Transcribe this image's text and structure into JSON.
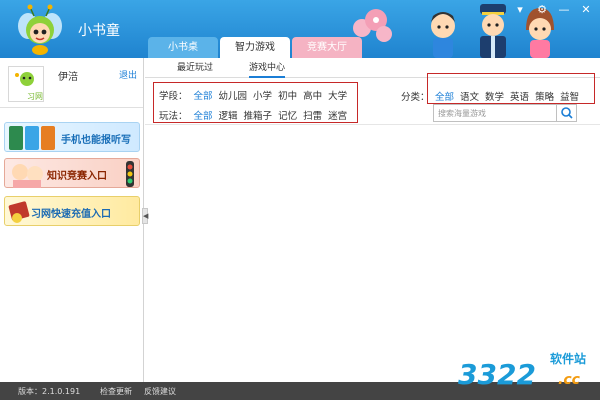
{
  "app": {
    "title": "小书童"
  },
  "window": {
    "menu_icon": "menu-icon",
    "settings_icon": "gear-icon",
    "minimize": "—",
    "close": "✕"
  },
  "tabs": [
    {
      "label": "小书桌",
      "active": false
    },
    {
      "label": "智力游戏",
      "active": true
    },
    {
      "label": "竞赛大厅",
      "active": false
    }
  ],
  "sidebar": {
    "username": "伊涪",
    "logout": "退出",
    "avatar_label": "习网",
    "banners": [
      {
        "text": "手机也能报听写"
      },
      {
        "text": "知识竞赛入口"
      },
      {
        "text": "习网快速充值入口"
      }
    ],
    "collapse_glyph": "◀"
  },
  "subtabs": [
    {
      "label": "最近玩过",
      "active": false
    },
    {
      "label": "游戏中心",
      "active": true
    }
  ],
  "filters": {
    "stage": {
      "label": "学段：",
      "options": [
        "全部",
        "幼儿园",
        "小学",
        "初中",
        "高中",
        "大学"
      ],
      "selected": "全部"
    },
    "play": {
      "label": "玩法：",
      "options": [
        "全部",
        "逻辑",
        "推箱子",
        "记忆",
        "扫雷",
        "迷宫"
      ],
      "selected": "全部"
    },
    "category": {
      "label": "分类：",
      "options": [
        "全部",
        "语文",
        "数学",
        "英语",
        "策略",
        "益智"
      ],
      "selected": "全部"
    }
  },
  "search": {
    "placeholder": "搜索海量游戏"
  },
  "footer": {
    "version": "版本：2.1.0.191",
    "check_update": "检查更新",
    "feedback": "反馈建议"
  },
  "watermark": {
    "text_main": "3322",
    "text_sub": "软件站",
    "text_cc": ".cc"
  },
  "colors": {
    "accent": "#1b7ed6",
    "header": "#2a95dc",
    "highlight": "#c62828"
  }
}
